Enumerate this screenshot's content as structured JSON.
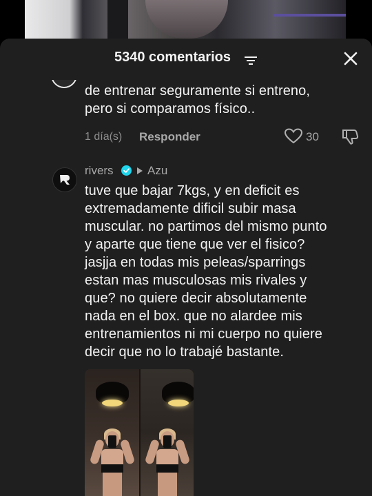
{
  "header": {
    "title": "5340 comentarios"
  },
  "comments": [
    {
      "text_lines": [
        "de entrenar seguramente si entreno,",
        "pero si comparamos físico.."
      ],
      "time": "1 día(s)",
      "reply_label": "Responder",
      "likes": "30"
    },
    {
      "username": "rivers",
      "reply_to": "Azu",
      "avatar_letter": "R",
      "text_lines": [
        "tuve que bajar 7kgs, y en deficit es",
        "extremadamente dificil subir masa",
        "muscular. no partimos del mismo punto",
        "y aparte que tiene que ver el fisico?",
        "jasjja en todas mis peleas/sparrings",
        "estan mas musculosas mis rivales y",
        "que? no quiere decir absolutamente",
        "nada en el box. que no alardee mis",
        "entrenamientos ni mi cuerpo no quiere",
        "decir que no lo trabajé bastante."
      ]
    }
  ],
  "colors": {
    "sheet_bg": "#1f1f1f",
    "verified": "#20d5ec",
    "text_primary": "#f3f3f3",
    "text_secondary": "#a8a8a8"
  }
}
